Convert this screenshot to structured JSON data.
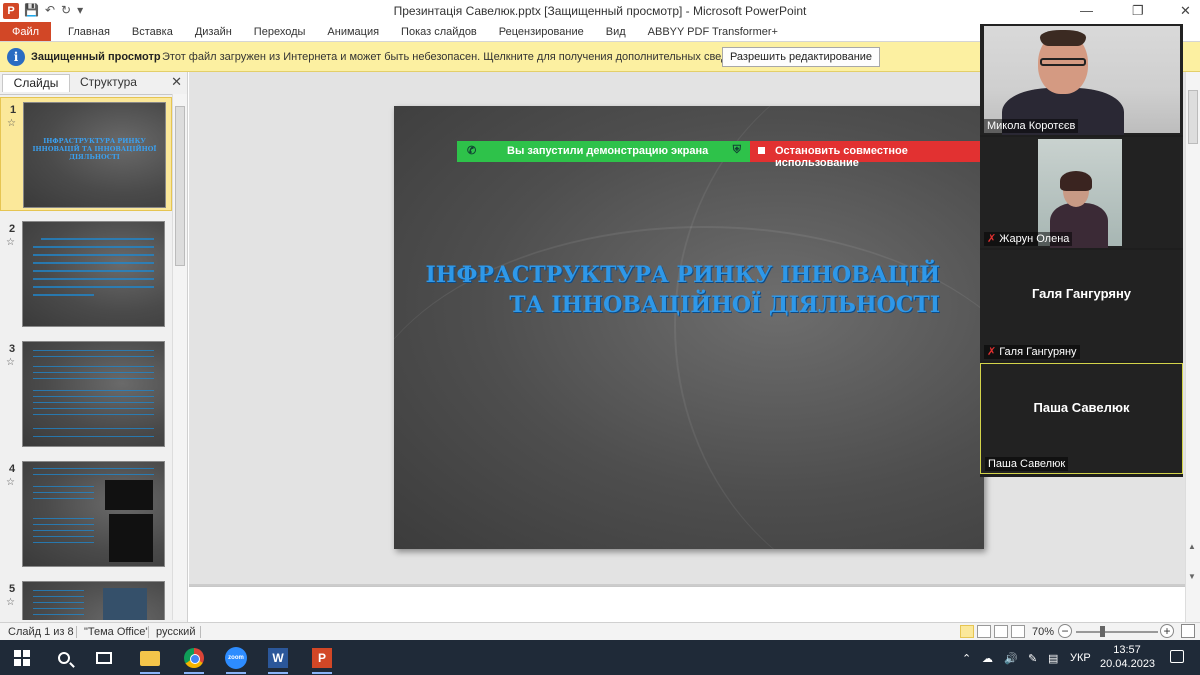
{
  "window": {
    "title": "Презинтація Савелюк.pptx [Защищенный просмотр]  -  Microsoft PowerPoint",
    "logo_letter": "P"
  },
  "ribbon": {
    "tabs": [
      "Файл",
      "Главная",
      "Вставка",
      "Дизайн",
      "Переходы",
      "Анимация",
      "Показ слайдов",
      "Рецензирование",
      "Вид",
      "ABBYY PDF Transformer+"
    ]
  },
  "protected_bar": {
    "title": "Защищенный просмотр",
    "message": "Этот файл загружен из Интернета и может быть небезопасен. Щелкните для получения дополнительных сведений.",
    "button": "Разрешить редактирование"
  },
  "left_pane": {
    "tab_slides": "Слайды",
    "tab_outline": "Структура",
    "close": "✕",
    "slides": [
      {
        "num": "1",
        "title": "ІНФРАСТРУКТУРА РИНКУ ІННОВАЦІЙ ТА ІННОВАЦІЙНОЇ ДІЯЛЬНОСТІ"
      },
      {
        "num": "2",
        "title": ""
      },
      {
        "num": "3",
        "title": ""
      },
      {
        "num": "4",
        "title": ""
      },
      {
        "num": "5",
        "title": ""
      }
    ]
  },
  "share_banner": {
    "status": "Вы запустили демонстрацию экрана",
    "stop": "Остановить совместное использование"
  },
  "slide": {
    "title_line1": "ІНФРАСТРУКТУРА РИНКУ ІННОВАЦІЙ",
    "title_line2": "ТА ІННОВАЦІЙНОЇ ДІЯЛЬНОСТІ"
  },
  "zoom": {
    "participants": [
      {
        "name": "Микола Коротєєв",
        "muted": false,
        "video": true
      },
      {
        "name": "Жарун Олена",
        "muted": true,
        "video": true
      },
      {
        "name": "Галя Гангуряну",
        "muted": true,
        "video": false
      },
      {
        "name": "Паша Савелюк",
        "muted": false,
        "video": false
      }
    ]
  },
  "status_bar": {
    "slide_info": "Слайд 1 из 8",
    "theme": "\"Тема Office\"",
    "language": "русский",
    "zoom": "70%"
  },
  "taskbar": {
    "zoom_label": "zoom",
    "word_letter": "W",
    "ppt_letter": "P",
    "language": "УКР",
    "time": "13:57",
    "date": "20.04.2023"
  }
}
